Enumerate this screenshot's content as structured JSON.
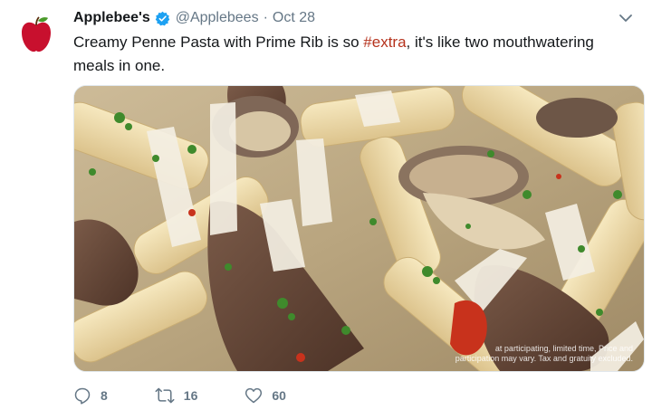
{
  "tweet": {
    "display_name": "Applebee's",
    "handle": "@Applebees",
    "separator": "·",
    "date": "Oct 28",
    "text_before": "Creamy Penne Pasta with Prime Rib is so ",
    "hashtag": "#extra",
    "text_after": ", it's like two mouthwatering meals in one."
  },
  "media": {
    "disclaimer_line1": "at participating, limited time, Price and",
    "disclaimer_line2": "participation may vary. Tax and gratuity excluded."
  },
  "actions": {
    "reply_count": "8",
    "retweet_count": "16",
    "like_count": "60"
  },
  "icons": {
    "avatar": "apple-logo-icon",
    "verified": "verified-badge-icon",
    "menu": "chevron-down-icon",
    "reply": "reply-icon",
    "retweet": "retweet-icon",
    "like": "heart-icon"
  },
  "colors": {
    "brand_red": "#c8102e",
    "verified_blue": "#1da1f2",
    "hashtag": "#b5321c",
    "secondary_text": "#657786"
  }
}
